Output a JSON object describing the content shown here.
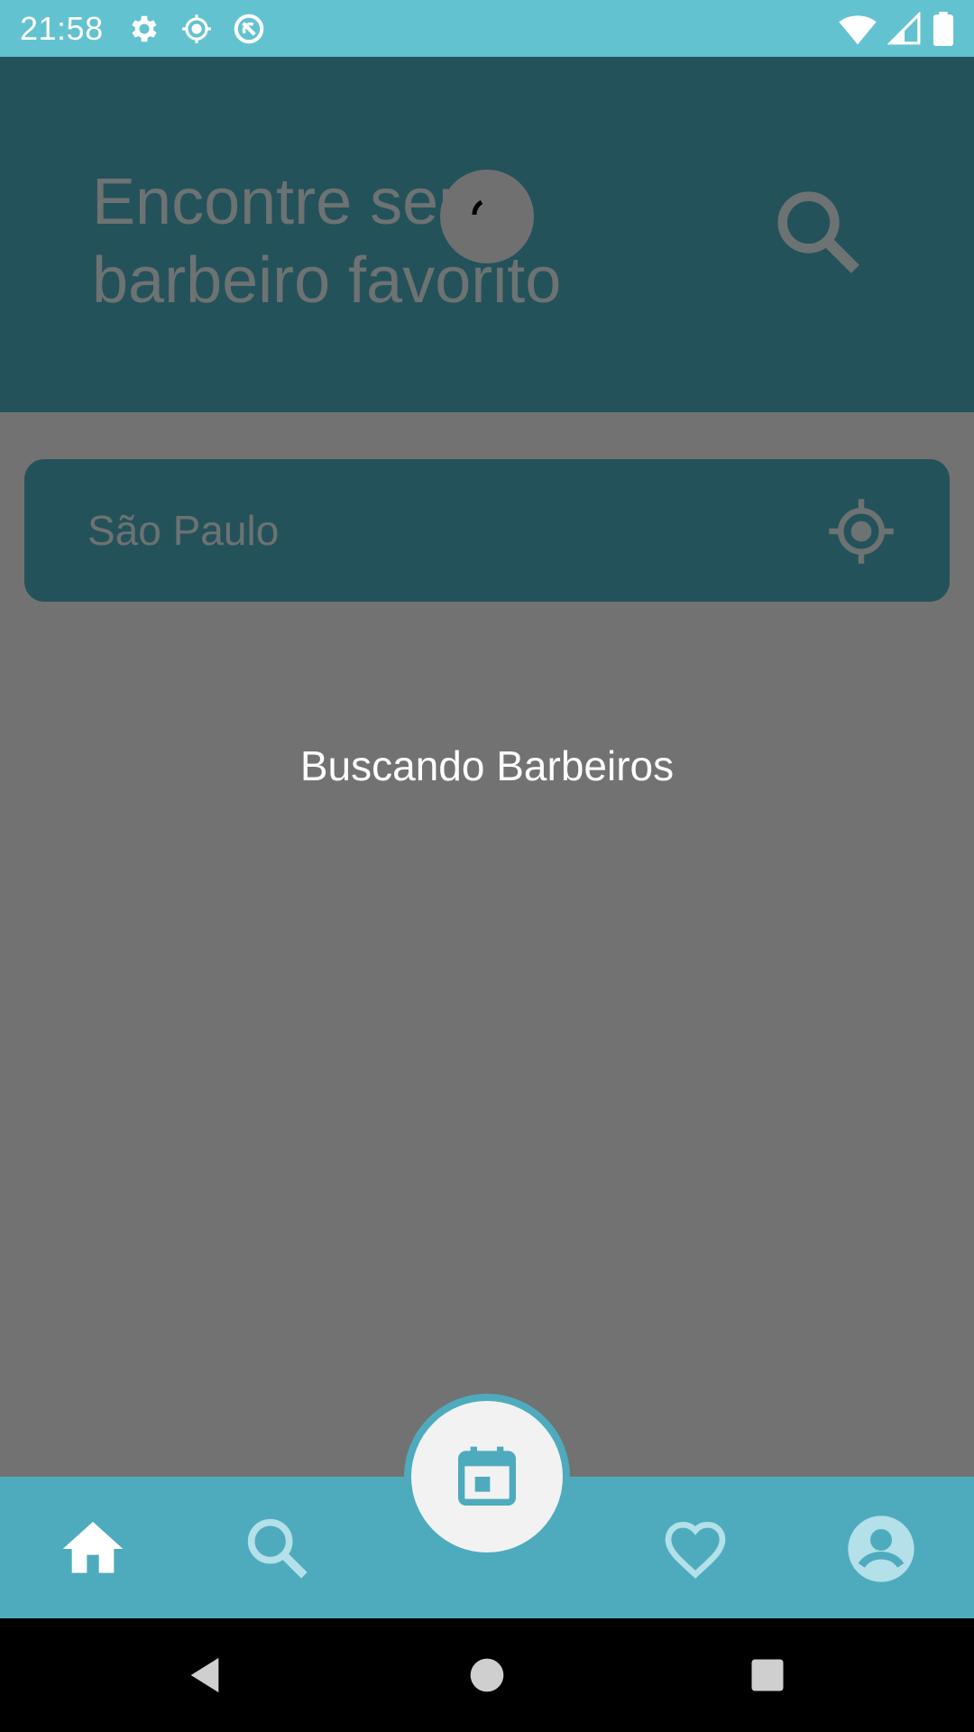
{
  "status_bar": {
    "time": "21:58",
    "icons_left": [
      "settings-icon",
      "location-icon",
      "sync-icon"
    ],
    "icons_right": [
      "wifi-icon",
      "signal-icon",
      "battery-icon"
    ]
  },
  "header": {
    "title": "Encontre seu\nbarbeiro favorito",
    "search_icon": "search-icon"
  },
  "location": {
    "placeholder": "São Paulo",
    "value": "",
    "gps_icon": "my-location-icon"
  },
  "status": {
    "loading_text": "Buscando Barbeiros"
  },
  "bottom_nav": {
    "items": [
      "home-icon",
      "search-icon",
      "calendar-icon",
      "heart-icon",
      "account-icon"
    ],
    "active": "home"
  },
  "colors": {
    "status_bar": "#63c2d0",
    "header": "#24525b",
    "overlay_bg": "#727272",
    "bottom_nav": "#4eabbd",
    "fab": "#f2f2f2"
  }
}
